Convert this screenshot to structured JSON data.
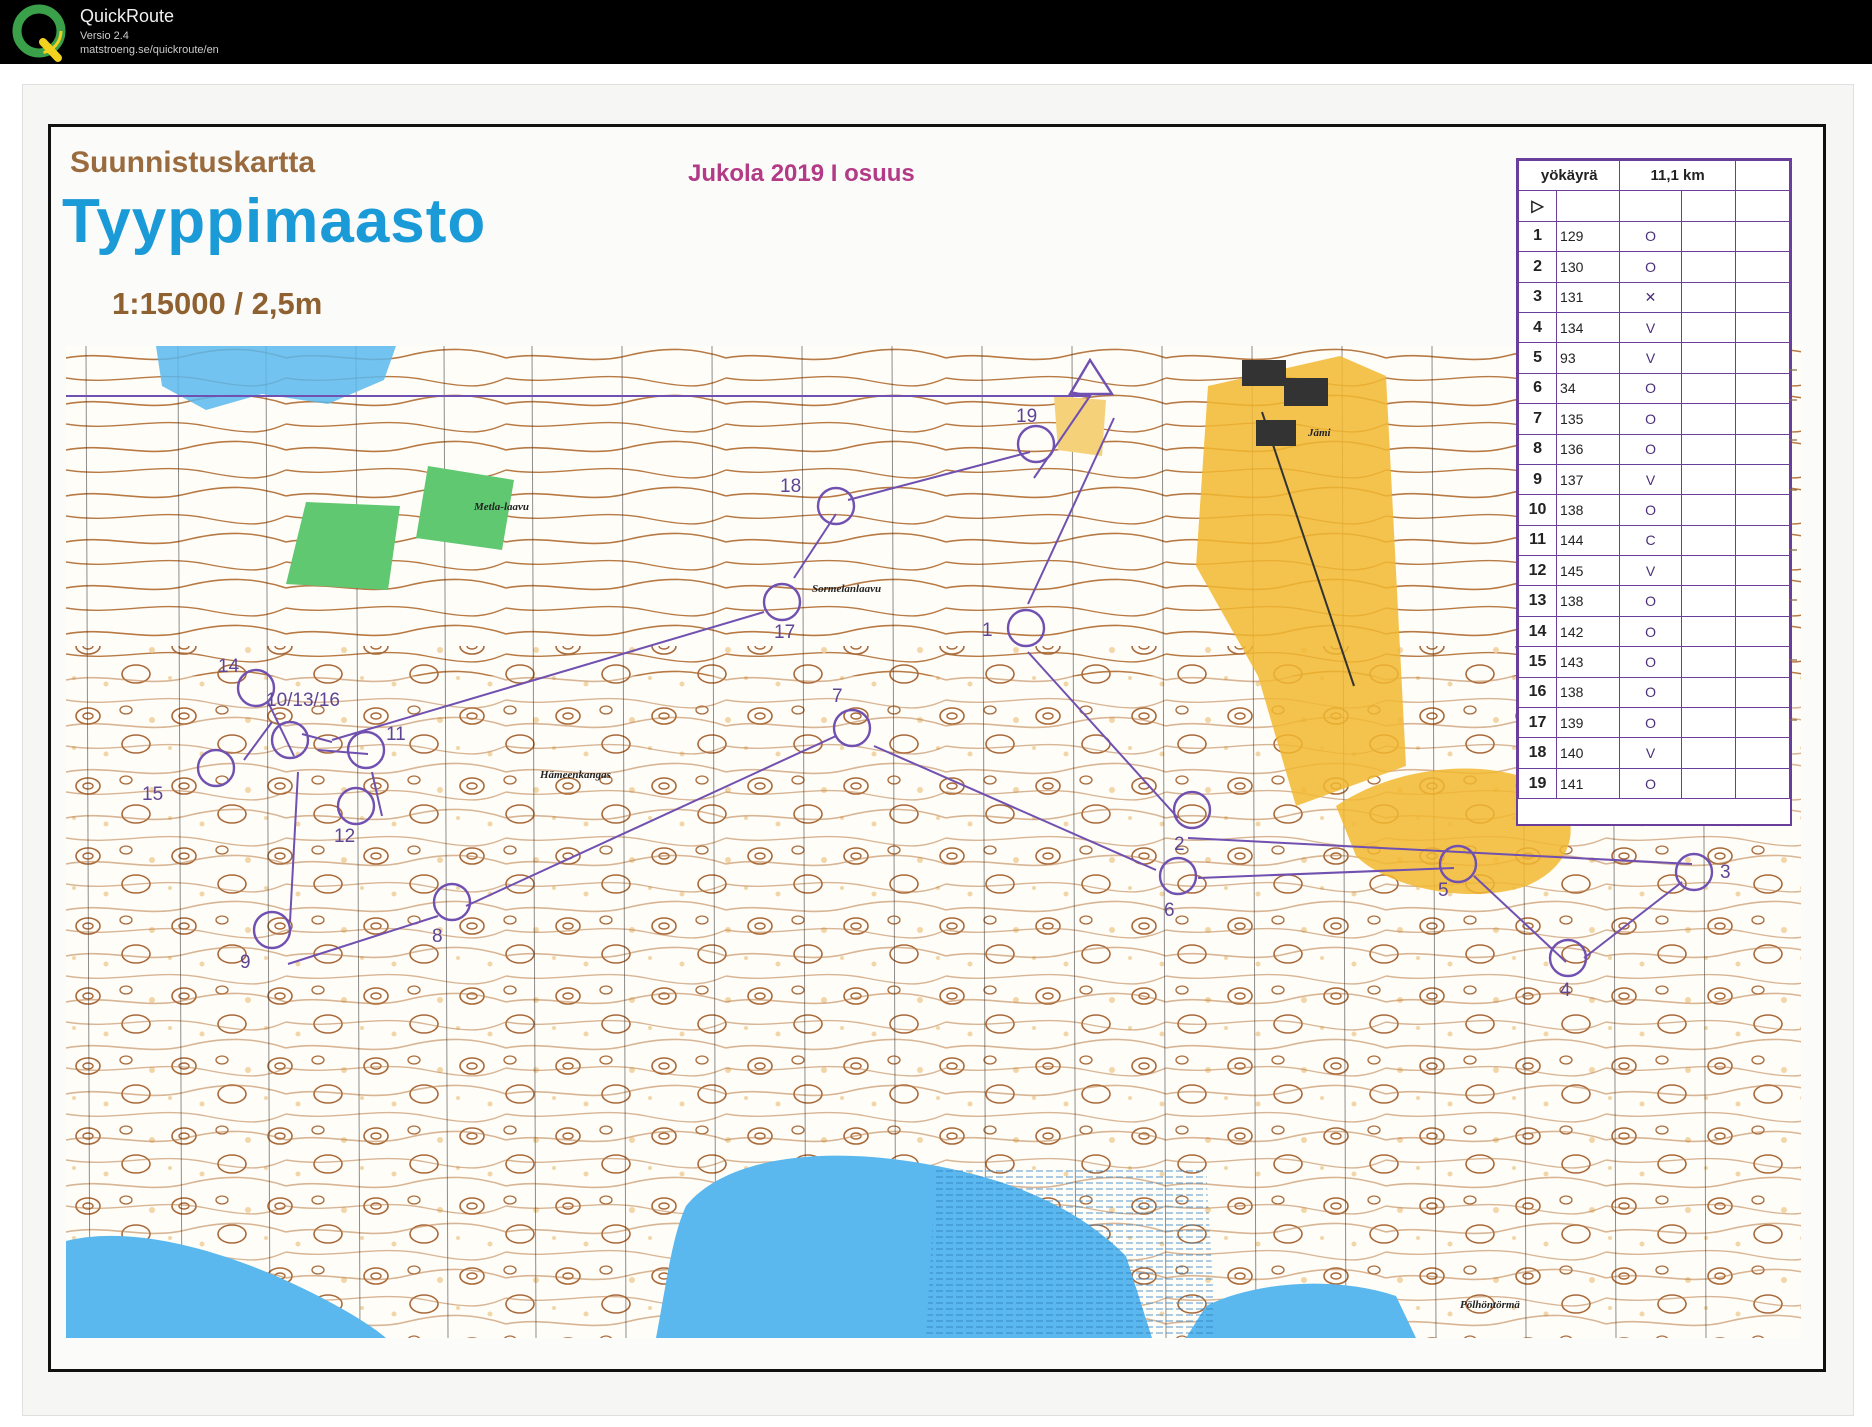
{
  "app": {
    "title": "QuickRoute",
    "version": "Versio 2.4",
    "url": "matstroeng.se/quickroute/en",
    "logo_letter": "Q"
  },
  "map": {
    "subtitle": "Suunnistuskartta",
    "title": "Tyyppimaasto",
    "scale": "1:15000 / 2,5m",
    "event": "Jukola 2019 I osuus",
    "place_names": {
      "metla": "Metla-laavu",
      "sormelan": "Sormelanlaavu",
      "hameenkangas": "Hämeenkangas",
      "jami": "Jämi",
      "polhontorma": "Pölhöntörmä"
    },
    "colors": {
      "course": "#7050b0",
      "contour": "#9a5a28",
      "water": "#5ab8ee",
      "green": "#5fc870",
      "yellow": "#f2b830",
      "paper": "#fffdf7"
    },
    "control_labels": [
      "1",
      "2",
      "3",
      "4",
      "5",
      "6",
      "7",
      "8",
      "9",
      "10/13/16",
      "11",
      "12",
      "14",
      "15",
      "17",
      "18",
      "19"
    ]
  },
  "descriptions": {
    "course": "yökäyrä",
    "length": "11,1 km",
    "start_symbol": "▷",
    "rows": [
      {
        "num": "1",
        "code": "129",
        "sym": "O"
      },
      {
        "num": "2",
        "code": "130",
        "sym": "O"
      },
      {
        "num": "3",
        "code": "131",
        "sym": "✕"
      },
      {
        "num": "4",
        "code": "134",
        "sym": "V"
      },
      {
        "num": "5",
        "code": "93",
        "sym": "V"
      },
      {
        "num": "6",
        "code": "34",
        "sym": "O"
      },
      {
        "num": "7",
        "code": "135",
        "sym": "O"
      },
      {
        "num": "8",
        "code": "136",
        "sym": "O"
      },
      {
        "num": "9",
        "code": "137",
        "sym": "V"
      },
      {
        "num": "10",
        "code": "138",
        "sym": "O"
      },
      {
        "num": "11",
        "code": "144",
        "sym": "C"
      },
      {
        "num": "12",
        "code": "145",
        "sym": "V"
      },
      {
        "num": "13",
        "code": "138",
        "sym": "O"
      },
      {
        "num": "14",
        "code": "142",
        "sym": "O"
      },
      {
        "num": "15",
        "code": "143",
        "sym": "O"
      },
      {
        "num": "16",
        "code": "138",
        "sym": "O"
      },
      {
        "num": "17",
        "code": "139",
        "sym": "O"
      },
      {
        "num": "18",
        "code": "140",
        "sym": "V"
      },
      {
        "num": "19",
        "code": "141",
        "sym": "O"
      }
    ]
  }
}
